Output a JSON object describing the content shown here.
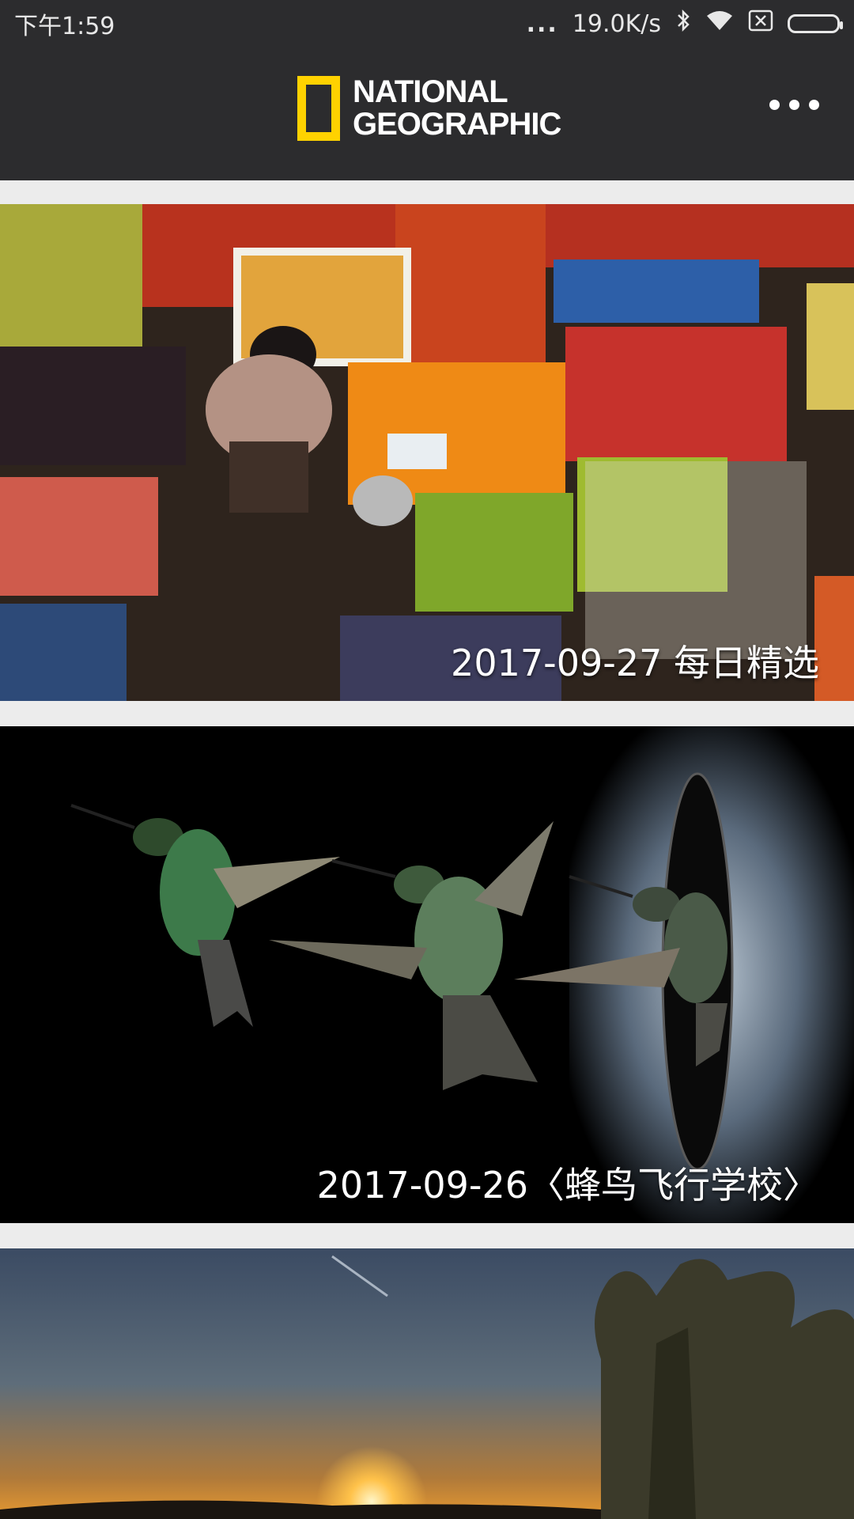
{
  "status_bar": {
    "time": "下午1:59",
    "dots": "...",
    "speed": "19.0K/s",
    "icons": [
      "bluetooth-icon",
      "wifi-icon",
      "sim-icon",
      "battery-icon"
    ]
  },
  "header": {
    "logo_line1": "NATIONAL",
    "logo_line2": "GEOGRAPHIC",
    "more_icon": "more-icon",
    "logo_color": "#ffd200",
    "background": "#2c2c2e"
  },
  "feed": {
    "items": [
      {
        "caption": "2017-09-27 每日精选",
        "image": "fruit-market-photo"
      },
      {
        "caption": "2017-09-26〈蜂鸟飞行学校〉",
        "image": "hummingbirds-photo"
      },
      {
        "caption": "",
        "image": "desert-sunset-photo"
      }
    ]
  }
}
